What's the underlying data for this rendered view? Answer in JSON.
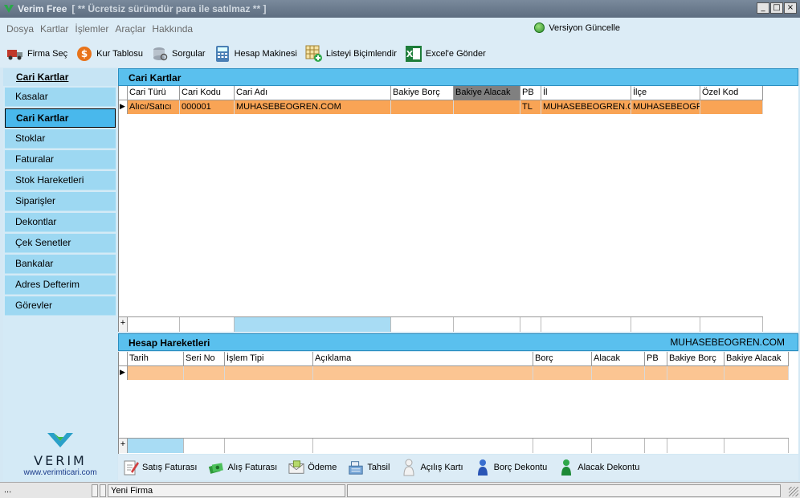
{
  "window": {
    "title": "Verim Free",
    "subtitle": "[  ** Ücretsiz sürümdür para ile satılmaz **  ]"
  },
  "menu": [
    "Dosya",
    "Kartlar",
    "İşlemler",
    "Araçlar",
    "Hakkında"
  ],
  "update_label": "Versiyon Güncelle",
  "toolbar": [
    {
      "label": "Firma Seç",
      "icon": "truck-icon"
    },
    {
      "label": "Kur Tablosu",
      "icon": "dollar-icon"
    },
    {
      "label": "Sorgular",
      "icon": "database-icon"
    },
    {
      "label": "Hesap Makinesi",
      "icon": "calculator-icon"
    },
    {
      "label": "Listeyi Biçimlendir",
      "icon": "grid-format-icon"
    },
    {
      "label": "Excel'e Gönder",
      "icon": "excel-icon"
    }
  ],
  "sidebar": {
    "header": "Cari Kartlar",
    "items": [
      "Kasalar",
      "Cari Kartlar",
      "Stoklar",
      "Faturalar",
      "Stok Hareketleri",
      "Siparişler",
      "Dekontlar",
      "Çek Senetler",
      "Bankalar",
      "Adres Defterim",
      "Görevler"
    ],
    "active": "Cari Kartlar",
    "logo_text": "VERIM",
    "logo_url": "www.verimticari.com"
  },
  "cari_panel": {
    "title": "Cari Kartlar",
    "columns": [
      "Cari Türü",
      "Cari Kodu",
      "Cari Adı",
      "Bakiye Borç",
      "Bakiye Alacak",
      "PB",
      "İl",
      "İlçe",
      "Özel Kod"
    ],
    "rows": [
      [
        "Alıcı/Satıcı",
        "000001",
        "MUHASEBEOGREN.COM",
        "",
        "",
        "TL",
        "MUHASEBEOGREN.COM",
        "MUHASEBEOGREN.COM",
        ""
      ]
    ],
    "add_symbol": "+"
  },
  "hareket_panel": {
    "title": "Hesap Hareketleri",
    "right_label": "MUHASEBEOGREN.COM",
    "columns": [
      "Tarih",
      "Seri No",
      "İşlem Tipi",
      "Açıklama",
      "Borç",
      "Alacak",
      "PB",
      "Bakiye Borç",
      "Bakiye Alacak"
    ],
    "add_symbol": "+"
  },
  "actions": [
    {
      "label": "Satış Faturası",
      "icon": "pencil-doc-icon"
    },
    {
      "label": "Alış Faturası",
      "icon": "money-icon"
    },
    {
      "label": "Ödeme",
      "icon": "envelope-icon"
    },
    {
      "label": "Tahsil",
      "icon": "register-icon"
    },
    {
      "label": "Açılış Kartı",
      "icon": "person-white-icon"
    },
    {
      "label": "Borç Dekontu",
      "icon": "person-blue-icon"
    },
    {
      "label": "Alacak Dekontu",
      "icon": "person-green-icon"
    }
  ],
  "status": {
    "left": "...",
    "firm": "Yeni Firma"
  },
  "colors": {
    "selected_row": "#f9a455",
    "panel_header": "#5ac0ee",
    "sidebar_item": "#9dd8f2",
    "sidebar_active": "#49b8ec"
  }
}
